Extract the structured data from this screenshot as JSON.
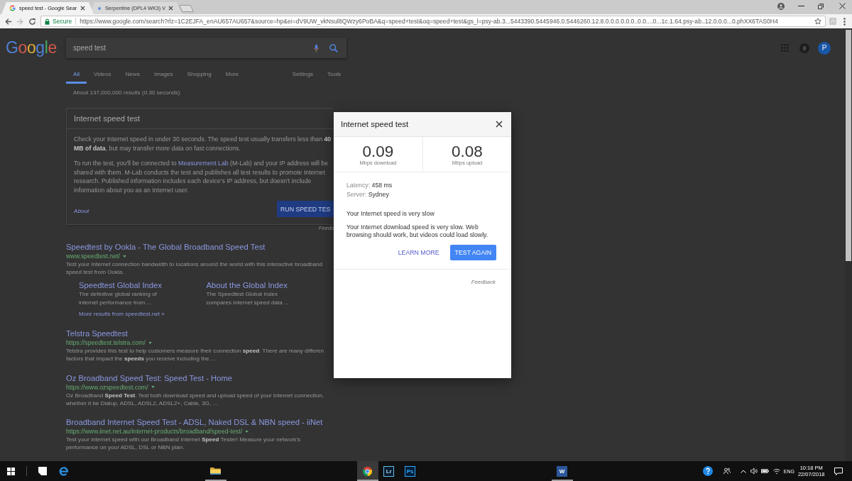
{
  "browser": {
    "tabs": [
      {
        "title": "speed test - Google Sear",
        "kind": "google",
        "selected": true
      },
      {
        "title": "Serpentine (DPL4 WK3) V",
        "kind": "page",
        "selected": false
      }
    ],
    "nav_buttons": [
      {
        "kind": "back",
        "disabled": false
      },
      {
        "kind": "forward",
        "disabled": true
      },
      {
        "kind": "reload",
        "disabled": false
      }
    ],
    "address_bar": {
      "secure_label": "Secure",
      "url": "https://www.google.com/search?rlz=1C2EJFA_enAU657AU657&source=hp&ei=dV9UW_vkNsul8QWzy6PoBA&q=speed+test&oq=speed+test&gs_l=psy-ab.3...5443390.5445946.0.5446260.12.8.0.0.0.0.0.0..0.0....0...1c.1.64.psy-ab..12.0.0.0...0.phXX6TAS0H4"
    }
  },
  "google_header": {
    "logo": "Google",
    "query": "speed test",
    "avatar_initial": "P"
  },
  "search_tabs": [
    {
      "label": "All",
      "selected": true
    },
    {
      "label": "Videos",
      "selected": false
    },
    {
      "label": "News",
      "selected": false
    },
    {
      "label": "Images",
      "selected": false
    },
    {
      "label": "Shopping",
      "selected": false
    },
    {
      "label": "More",
      "selected": false
    }
  ],
  "search_options": [
    "Settings",
    "Tools"
  ],
  "result_stats": "About 137,000,000 results (0.30 seconds)",
  "speed_card": {
    "title": "Internet speed test",
    "intro": "Check your Internet speed in under 30 seconds. The speed test usually transfers less than **40**\n**MB of data**, but may transfer more data on fast connections.",
    "privacy": {
      "before": "To run the test, you'll be connected to ",
      "link": "Measurement Lab",
      "after": " (M-Lab) and your IP address will be\nshared with them. M-Lab conducts the test and publishes all test results to promote Internet\nresearch. Published information includes each device's IP address, but doesn't include\ninformation about you as an Internet user."
    },
    "about_link": "About",
    "run_button": "RUN SPEED TES",
    "feedback": "Feedb"
  },
  "results": [
    {
      "title": "Speedtest by Ookla - The Global Broadband Speed Test",
      "url": "www.speedtest.net/",
      "snippet": "Test your Internet connection bandwidth to locations around the world with this interactive broadband\nspeed test from Ookla.",
      "sitelinks": [
        {
          "title": "Speedtest Global Index",
          "description": "The definitive global ranking of\ninternet performance from ..."
        },
        {
          "title": "About the Global Index",
          "description": "The Speedtest Global Index\ncompares internet speed data ..."
        }
      ],
      "more_link": "More results from speedtest.net »"
    },
    {
      "title": "Telstra Speedtest",
      "url": "https://speedtest.telstra.com/",
      "snippet": "Telstra provides this test to help customers measure their connection **speed**. There are many differen\nfactors that impact the **speeds** you receive including the ..."
    },
    {
      "title": "Oz Broadband Speed Test: Speed Test - Home",
      "url": "https://www.ozspeedtest.com/",
      "snippet": "Oz Broadband **Speed Test**. Test both download speed and upload speed of your Internet connection,\nwhether it be Dialup, ADSL, ADSL2, ADSL2+, Cable, 3G, ..."
    },
    {
      "title": "Broadband Internet Speed Test - ADSL, Naked DSL & NBN speed - iiNet",
      "url": "https://www.iinet.net.au/internet-products/broadband/speed-test/",
      "snippet": "Test your internet speed with our Broadband Internet **Speed** Tester! Measure your network's\nperformance on your ADSL, DSL or NBN plan."
    }
  ],
  "speed_dialog": {
    "title": "Internet speed test",
    "speeds": [
      {
        "value": "0.09",
        "unit": "Mbps download"
      },
      {
        "value": "0.08",
        "unit": "Mbps upload"
      }
    ],
    "latency_label": "Latency:",
    "latency": "458 ms",
    "server_label": "Server:",
    "server": "Sydney",
    "verdict": "Your Internet speed is very slow",
    "detail": "Your Internet download speed is very slow. Web\nbrowsing should work, but videos could load slowly.",
    "buttons": [
      {
        "label": "LEARN MORE",
        "kind": "text"
      },
      {
        "label": "TEST AGAIN",
        "kind": "primary"
      }
    ],
    "feedback": "Feedback"
  },
  "taskbar": {
    "apps": [
      {
        "kind": "notes",
        "running": false,
        "selected": false
      },
      {
        "kind": "edge",
        "running": false,
        "selected": false
      },
      {
        "kind": "explorer",
        "running": true,
        "selected": false
      },
      {
        "kind": "chrome",
        "running": true,
        "selected": true
      },
      {
        "kind": "lightroom",
        "label": "Lr",
        "running": false,
        "selected": false
      },
      {
        "kind": "photoshop",
        "label": "Ps",
        "running": false,
        "selected": false
      },
      {
        "kind": "word",
        "label": "W",
        "running": true,
        "selected": false
      }
    ],
    "tray": {
      "language": "ENG",
      "time": "10:18 PM",
      "date": "22/07/2018"
    }
  }
}
